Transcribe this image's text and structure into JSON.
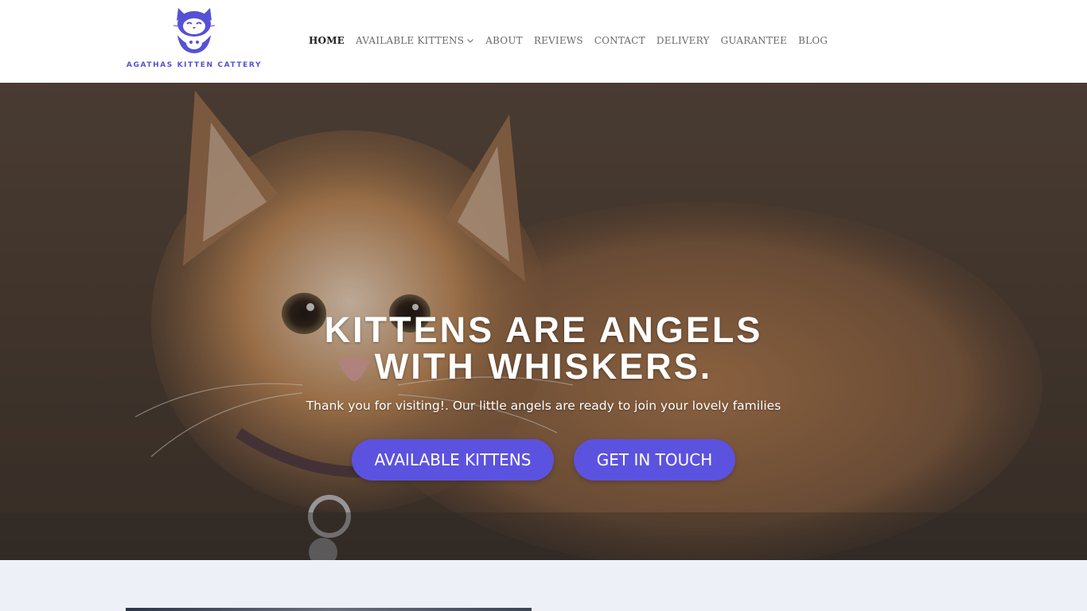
{
  "brand": {
    "name": "AGATHAS KITTEN CATTERY",
    "logo_icon": "cat-face-logo",
    "accent_color": "#5c52e0"
  },
  "nav": {
    "items": [
      {
        "label": "HOME",
        "active": true
      },
      {
        "label": "AVAILABLE KITTENS",
        "has_dropdown": true
      },
      {
        "label": "ABOUT"
      },
      {
        "label": "REVIEWS"
      },
      {
        "label": "CONTACT"
      },
      {
        "label": "DELIVERY"
      },
      {
        "label": "GUARANTEE"
      },
      {
        "label": "BLOG"
      }
    ],
    "dropdown_icon": "chevron-down-icon"
  },
  "hero": {
    "title_line1": "KITTENS ARE ANGELS",
    "title_line2": "WITH WHISKERS.",
    "subtitle": "Thank you for visiting!. Our little angels are ready to join your lovely families",
    "primary_button": "AVAILABLE KITTENS",
    "secondary_button": "GET IN TOUCH",
    "background_image": "fluffy-ginger-kitten-with-collar-bell",
    "button_color": "#5c52e0"
  },
  "next_section": {
    "background_color": "#eef0f8"
  }
}
